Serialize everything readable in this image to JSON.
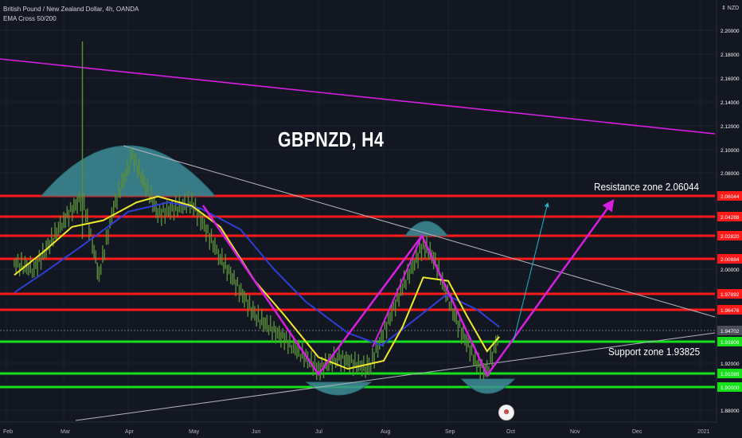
{
  "legend": {
    "symbol": "British Pound / New Zealand Dollar, 4h, OANDA",
    "indicator": "EMA Cross 50/200"
  },
  "headline": "GBPNZD, H4",
  "currency_label": "NZD",
  "annotations": {
    "resistance": "Resistance zone  2.06044",
    "support": "Support zone 1.93825"
  },
  "colors": {
    "background": "#131722",
    "price": "#5a8f3a",
    "ema50": "#f2e92b",
    "ema200": "#2f3fd6",
    "resistance": "#ff1a1a",
    "support": "#16e01a",
    "channel": "#d61fe0",
    "projection": "#18b8c8",
    "trendline": "#b2b5be",
    "dome": "#3d8d96"
  },
  "chart_data": {
    "type": "line",
    "title": "GBPNZD, H4",
    "x_tick_labels": [
      "Feb",
      "Mar",
      "Apr",
      "May",
      "Jun",
      "Jul",
      "Aug",
      "Sep",
      "Oct",
      "Nov",
      "Dec",
      "2021"
    ],
    "y_tick_labels": [
      "2.20000",
      "2.18000",
      "2.16000",
      "2.14000",
      "2.12000",
      "2.10000",
      "2.08000",
      "2.06044",
      "2.04288",
      "2.02820",
      "2.00884",
      "2.00000",
      "1.97892",
      "1.96476",
      "1.94702",
      "1.93806",
      "1.92000",
      "1.91089",
      "1.90000",
      "1.88000"
    ],
    "ylim": [
      1.87,
      2.21
    ],
    "resistance_levels": [
      2.06044,
      2.04288,
      2.0282,
      2.00884,
      1.97892,
      1.96476
    ],
    "support_levels": [
      1.93806,
      1.91089,
      1.9
    ],
    "last_price": 1.94702,
    "series": [
      {
        "name": "EMA 50",
        "x": [
          "2020-02-05",
          "2020-02-20",
          "2020-03-05",
          "2020-03-20",
          "2020-04-05",
          "2020-04-15",
          "2020-05-01",
          "2020-05-15",
          "2020-06-01",
          "2020-06-15",
          "2020-07-01",
          "2020-07-15",
          "2020-08-01",
          "2020-08-10",
          "2020-08-20",
          "2020-09-01",
          "2020-09-10",
          "2020-09-20",
          "2020-09-26"
        ],
        "y": [
          1.995,
          2.015,
          2.035,
          2.04,
          2.055,
          2.06,
          2.052,
          2.035,
          1.99,
          1.96,
          1.925,
          1.915,
          1.922,
          1.95,
          1.993,
          1.99,
          1.96,
          1.93,
          1.942
        ]
      },
      {
        "name": "EMA 200",
        "x": [
          "2020-02-05",
          "2020-02-20",
          "2020-03-10",
          "2020-04-01",
          "2020-04-20",
          "2020-05-05",
          "2020-05-25",
          "2020-06-10",
          "2020-06-25",
          "2020-07-15",
          "2020-07-31",
          "2020-08-15",
          "2020-08-31",
          "2020-09-15",
          "2020-09-26"
        ],
        "y": [
          1.98,
          1.997,
          2.02,
          2.047,
          2.055,
          2.05,
          2.033,
          2.0,
          1.972,
          1.945,
          1.935,
          1.955,
          1.978,
          1.965,
          1.95
        ]
      },
      {
        "name": "Price",
        "x": [
          "2020-02-05",
          "2020-02-15",
          "2020-03-01",
          "2020-03-10",
          "2020-03-18",
          "2020-03-25",
          "2020-04-03",
          "2020-04-15",
          "2020-05-01",
          "2020-05-15",
          "2020-06-01",
          "2020-06-15",
          "2020-07-01",
          "2020-07-10",
          "2020-07-25",
          "2020-08-10",
          "2020-08-20",
          "2020-08-25",
          "2020-09-05",
          "2020-09-15",
          "2020-09-20",
          "2020-09-26"
        ],
        "y": [
          2.005,
          2.0,
          2.04,
          2.06,
          1.995,
          2.05,
          2.095,
          2.045,
          2.055,
          2.01,
          1.96,
          1.94,
          1.915,
          1.925,
          1.915,
          1.985,
          2.02,
          2.01,
          1.955,
          1.92,
          1.912,
          1.945
        ]
      }
    ]
  }
}
